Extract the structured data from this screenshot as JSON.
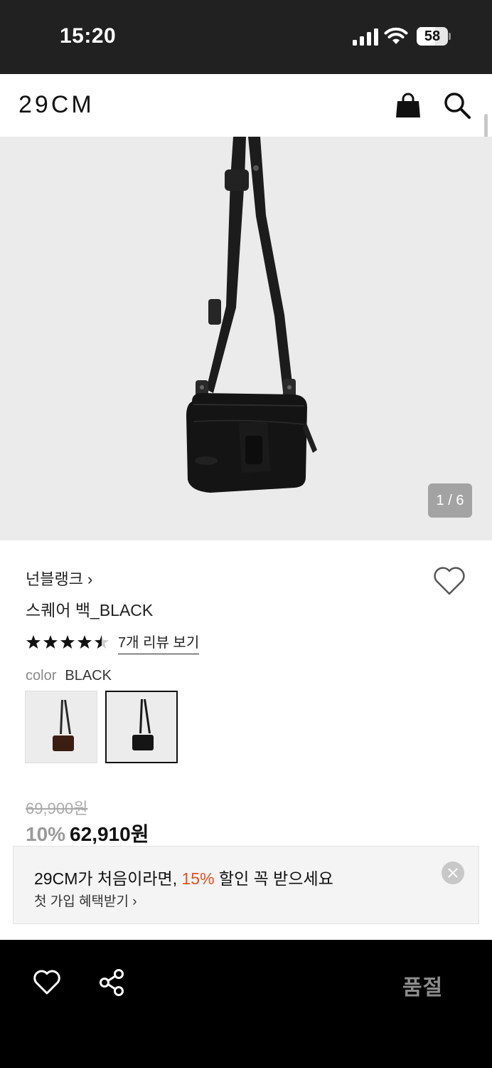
{
  "status_bar": {
    "time": "15:20",
    "battery": "58"
  },
  "header": {
    "logo": "29CM",
    "icons": [
      "shopping-bag-icon",
      "search-icon"
    ]
  },
  "gallery": {
    "counter": "1 / 6"
  },
  "product": {
    "brand": "넌블랭크",
    "brand_chevron": "›",
    "name": "스퀘어 백_BLACK",
    "rating": 4.5,
    "rating_max": 5,
    "review_link": "7개 리뷰 보기",
    "color_label": "color",
    "color_value": "BLACK",
    "swatches": [
      {
        "color": "BROWN",
        "selected": false
      },
      {
        "color": "BLACK",
        "selected": true
      }
    ],
    "original_price": "69,900원",
    "discount": "10%",
    "final_price": "62,910원"
  },
  "promo": {
    "line1_prefix": "29CM가 처음이라면, ",
    "line1_accent": "15%",
    "line1_suffix": " 할인 꼭 받으세요",
    "line2": "첫 가입 혜택받기 ›",
    "accent_color": "#e8501e"
  },
  "bottom_bar": {
    "soldout_label": "품절",
    "icons": [
      "heart-icon",
      "share-icon"
    ]
  }
}
